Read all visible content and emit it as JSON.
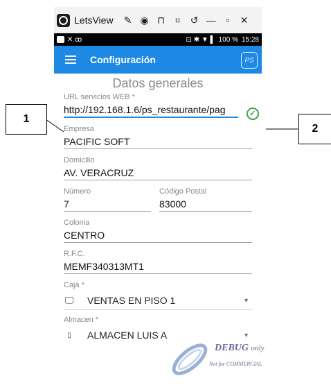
{
  "window": {
    "title": "LetsView",
    "tool_icons": [
      "✎",
      "◉",
      "⊓",
      "⌗",
      "↺",
      "—",
      "▫",
      "✕"
    ]
  },
  "status_bar": {
    "left_icons": "✕ ꝏ",
    "right_icons": "⊡ ✱ ▼ ▌",
    "battery": "100 %",
    "time": "15:28"
  },
  "app_bar": {
    "title": "Configuración",
    "logo_text": "PS"
  },
  "form": {
    "section_title": "Datos generales",
    "url": {
      "label": "URL servicios WEB *",
      "value": "http://192.168.1.6/ps_restaurante/pag"
    },
    "empresa": {
      "label": "Empresa",
      "value": "PACIFIC SOFT"
    },
    "domicilio": {
      "label": "Domicilio",
      "value": "AV. VERACRUZ"
    },
    "numero": {
      "label": "Número",
      "value": "7"
    },
    "codigo_postal": {
      "label": "Código Postal",
      "value": "83000"
    },
    "colonia": {
      "label": "Colonia",
      "value": "CENTRO"
    },
    "rfc": {
      "label": "R.F.C.",
      "value": "MEMF340313MT1"
    },
    "caja": {
      "label": "Caja *",
      "value": "VENTAS EN PISO 1"
    },
    "almacen": {
      "label": "Almacen *",
      "value": "ALMACEN LUIS A"
    }
  },
  "callouts": {
    "one": "1",
    "two": "2"
  },
  "watermark": {
    "line1": "DEBUG",
    "line1_suffix": "only",
    "line2": "Not for COMMERCIAL"
  }
}
